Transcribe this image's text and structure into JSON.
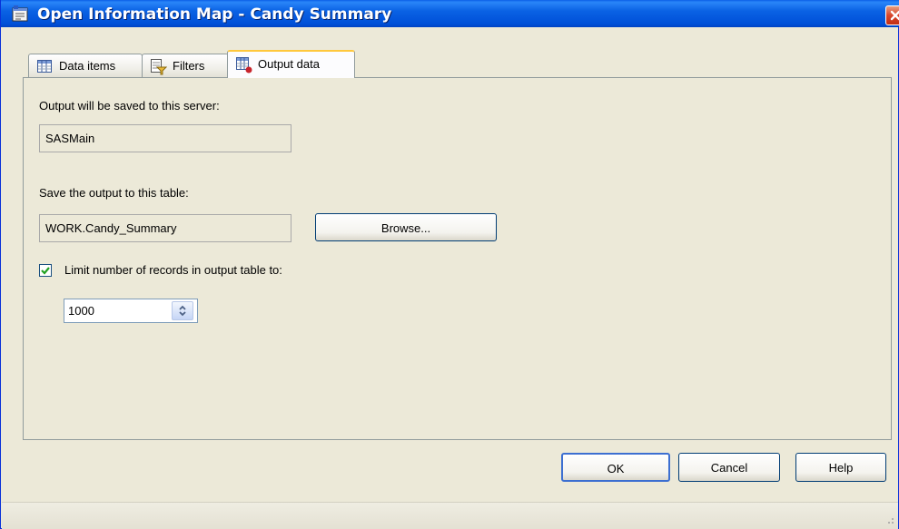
{
  "window": {
    "title": "Open Information Map - Candy Summary",
    "title_icon": "information-map-icon",
    "close_icon": "close-icon"
  },
  "tabs": [
    {
      "label": "Data items",
      "icon": "data-items-icon",
      "active": false
    },
    {
      "label": "Filters",
      "icon": "filters-icon",
      "active": false
    },
    {
      "label": "Output data",
      "icon": "output-data-icon",
      "active": true
    }
  ],
  "output": {
    "server_label": "Output will be saved to this server:",
    "server_value": "SASMain",
    "table_label": "Save the output to this table:",
    "table_value": "WORK.Candy_Summary",
    "browse_label": "Browse...",
    "limit_label": "Limit number of records in output table to:",
    "limit_checked": true,
    "limit_value": "1000"
  },
  "buttons": {
    "ok": "OK",
    "cancel": "Cancel",
    "help": "Help"
  },
  "colors": {
    "dialog_bg": "#ECE9D8",
    "titlebar": "#0A62E4",
    "active_tab_accent": "#FFC83C"
  }
}
